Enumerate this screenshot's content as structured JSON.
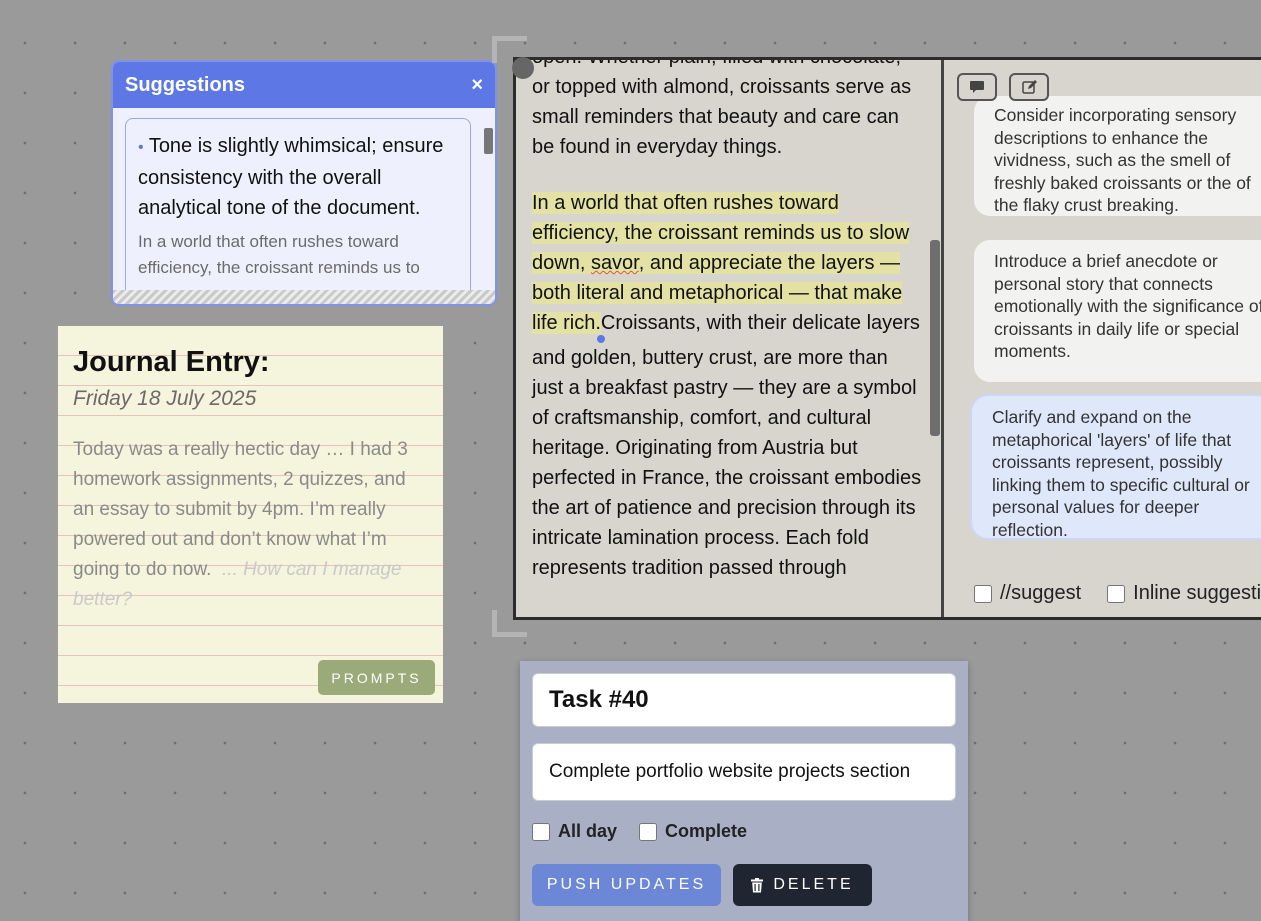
{
  "suggestions": {
    "title": "Suggestions",
    "close_label": "×",
    "point": "Tone is slightly whimsical; ensure consistency with the overall analytical tone of the document.",
    "quote": "In a world that often rushes toward efficiency, the croissant reminds us to"
  },
  "journal": {
    "title": "Journal Entry:",
    "date": "Friday 18 July 2025",
    "body": "Today was a really hectic day … I had 3 homework assignments, 2 quizzes, and an essay to submit by 4pm. I’m really powered out and don’t know what I’m going to do now.",
    "prompt": "... How can I manage better?",
    "prompts_button": "PROMPTS"
  },
  "document": {
    "para1": "open. Whether plain, filled with chocolate, or topped with almond, croissants serve as small reminders that beauty and care can be found in everyday things.",
    "highlight_a": "In a world that often rushes toward efficiency, the croissant reminds us to slow down, ",
    "highlight_word": "savor",
    "highlight_b": ", and appreciate the layers — both literal and metaphorical — that make life rich.",
    "para2_rest": "Croissants, with their delicate layers and golden, buttery crust, are more than just a breakfast pastry — they are a symbol of craftsmanship, comfort, and cultural heritage. Originating from Austria but perfected in France, the croissant embodies the art of patience and precision through its intricate lamination process. Each fold represents tradition passed through"
  },
  "comments": {
    "items": [
      "Consider incorporating sensory descriptions to enhance the vividness, such as the smell of freshly baked croissants or the of the flaky crust breaking.",
      "Introduce a brief anecdote or personal story that connects emotionally with the significance of croissants in daily life or special moments.",
      "Clarify and expand on the metaphorical 'layers' of life that croissants represent, possibly linking them to specific cultural or personal values for deeper reflection."
    ],
    "suggest_label": "//suggest",
    "inline_label": "Inline suggestions"
  },
  "task": {
    "title": "Task #40",
    "description": "Complete portfolio website projects section",
    "all_day_label": "All day",
    "complete_label": "Complete",
    "push_label": "PUSH UPDATES",
    "delete_label": "DELETE"
  },
  "icons": [
    "close-icon",
    "comment-icon",
    "edit-icon",
    "trash-icon"
  ]
}
